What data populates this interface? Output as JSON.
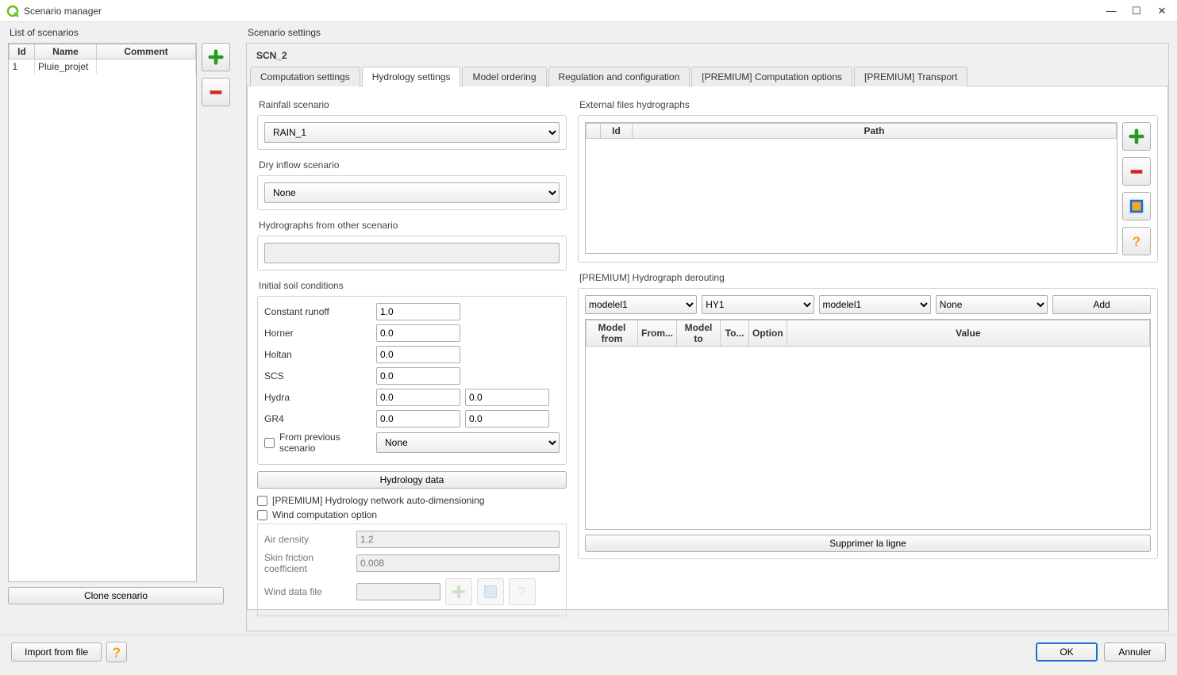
{
  "window": {
    "title": "Scenario manager"
  },
  "left": {
    "label": "List of scenarios",
    "headers": {
      "id": "Id",
      "name": "Name",
      "comment": "Comment"
    },
    "rows": [
      {
        "id": "1",
        "name": "Pluie_projet",
        "comment": ""
      }
    ],
    "clone_label": "Clone scenario"
  },
  "settings": {
    "label": "Scenario settings",
    "title": "SCN_2",
    "tabs": [
      "Computation settings",
      "Hydrology settings",
      "Model ordering",
      "Regulation and configuration",
      "[PREMIUM] Computation options",
      "[PREMIUM] Transport"
    ],
    "active_tab": 1,
    "rainfall": {
      "label": "Rainfall scenario",
      "value": "RAIN_1"
    },
    "dryinflow": {
      "label": "Dry inflow scenario",
      "value": "None"
    },
    "hydro_other": {
      "label": "Hydrographs from other scenario",
      "value": ""
    },
    "soil": {
      "label": "Initial soil conditions",
      "constant_runoff": {
        "label": "Constant runoff",
        "val": "1.0"
      },
      "horner": {
        "label": "Horner",
        "val": "0.0"
      },
      "holtan": {
        "label": "Holtan",
        "val": "0.0"
      },
      "scs": {
        "label": "SCS",
        "val": "0.0"
      },
      "hydra": {
        "label": "Hydra",
        "val1": "0.0",
        "val2": "0.0"
      },
      "gr4": {
        "label": "GR4",
        "val1": "0.0",
        "val2": "0.0"
      },
      "from_prev": {
        "label": "From previous scenario",
        "value": "None"
      }
    },
    "hydro_data_btn": "Hydrology data",
    "premium_auto": "[PREMIUM] Hydrology network auto-dimensioning",
    "wind_option": "Wind computation option",
    "wind": {
      "air_density": {
        "label": "Air density",
        "val": "1.2"
      },
      "skin_friction": {
        "label": "Skin friction coefficient",
        "val": "0.008"
      },
      "data_file": {
        "label": "Wind data file",
        "val": ""
      }
    },
    "ext": {
      "label": "External files hydrographs",
      "headers": {
        "id": "Id",
        "path": "Path"
      }
    },
    "derouting": {
      "label": "[PREMIUM] Hydrograph derouting",
      "c1": "modelel1",
      "c2": "HY1",
      "c3": "modelel1",
      "c4": "None",
      "add_btn": "Add",
      "headers": {
        "mf": "Model from",
        "fr": "From...",
        "mt": "Model to",
        "to": "To...",
        "op": "Option",
        "val": "Value"
      },
      "delete_btn": "Supprimer la ligne"
    }
  },
  "footer": {
    "import": "Import from file",
    "ok": "OK",
    "cancel": "Annuler"
  }
}
